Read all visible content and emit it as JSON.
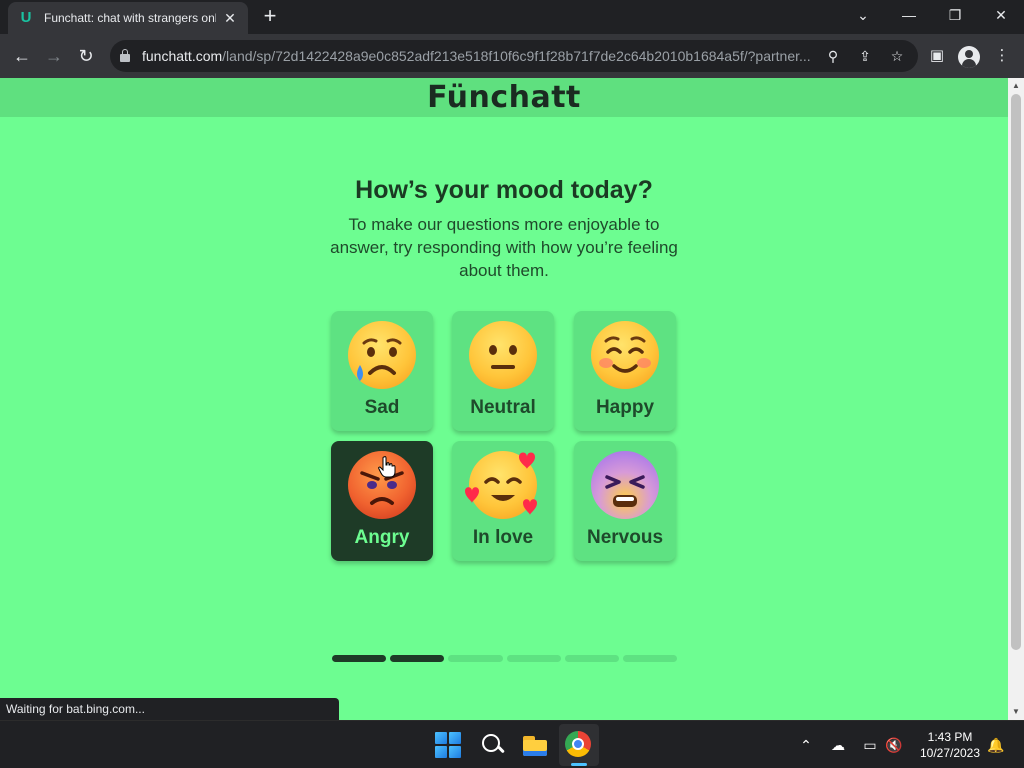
{
  "browser": {
    "tab_title": "Funchatt: chat with strangers onli",
    "new_tab": "+",
    "url_host": "funchatt.com",
    "url_path": "/land/sp/72d1422428a9e0c852adf213e518f10f6c9f1f28b71f7de2c64b2010b1684a5f/?partner...",
    "status_text": "Waiting for bat.bing.com..."
  },
  "site": {
    "logo": "Fünchatt",
    "question": "How’s your mood today?",
    "subtitle": "To make our questions more enjoyable to answer, try responding with how you’re feeling about them."
  },
  "moods": [
    {
      "label": "Sad",
      "selected": false
    },
    {
      "label": "Neutral",
      "selected": false
    },
    {
      "label": "Happy",
      "selected": false
    },
    {
      "label": "Angry",
      "selected": true
    },
    {
      "label": "In love",
      "selected": false
    },
    {
      "label": "Nervous",
      "selected": false
    }
  ],
  "progress": {
    "completed_steps": 2,
    "total_steps": 6
  },
  "taskbar": {
    "time": "1:43 PM",
    "date": "10/27/2023"
  },
  "colors": {
    "page_bg": "#6dfd91",
    "header_bg": "#5fe07f",
    "card_bg": "#5ee282",
    "selected_card_bg": "#1e3b27"
  }
}
